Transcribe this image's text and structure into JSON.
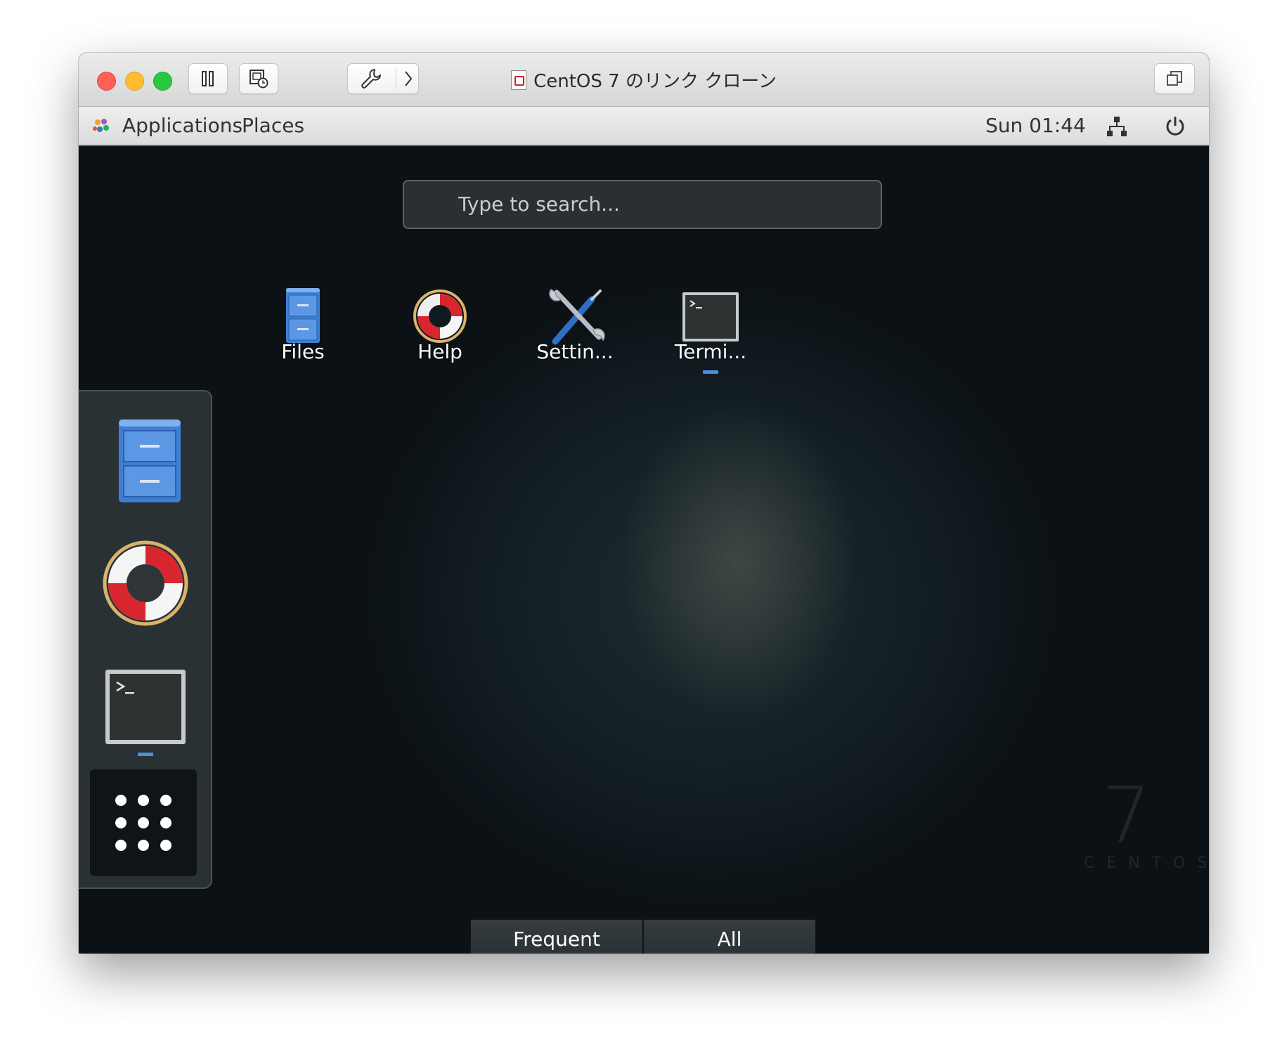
{
  "window": {
    "title": "CentOS 7 のリンク クローン"
  },
  "topbar": {
    "applications_label": "Applications",
    "places_label": "Places",
    "clock": "Sun 01:44"
  },
  "overview": {
    "search_placeholder": "Type to search...",
    "apps": [
      {
        "label": "Files"
      },
      {
        "label": "Help"
      },
      {
        "label": "Settin..."
      },
      {
        "label": "Termi..."
      }
    ],
    "tabs": {
      "frequent": "Frequent",
      "all": "All"
    }
  },
  "watermark": {
    "number": "7",
    "word": "CENTOS"
  },
  "colors": {
    "running_indicator": "#4a90d9",
    "titlebar": "#e3e3e3",
    "desktop": "#0c1116"
  },
  "icons": [
    "pause-icon",
    "snapshot-icon",
    "wrench-icon",
    "chevron-right-icon",
    "restore-window-icon",
    "network-icon",
    "power-icon",
    "files-icon",
    "help-icon",
    "settings-icon",
    "terminal-icon",
    "show-apps-icon"
  ]
}
